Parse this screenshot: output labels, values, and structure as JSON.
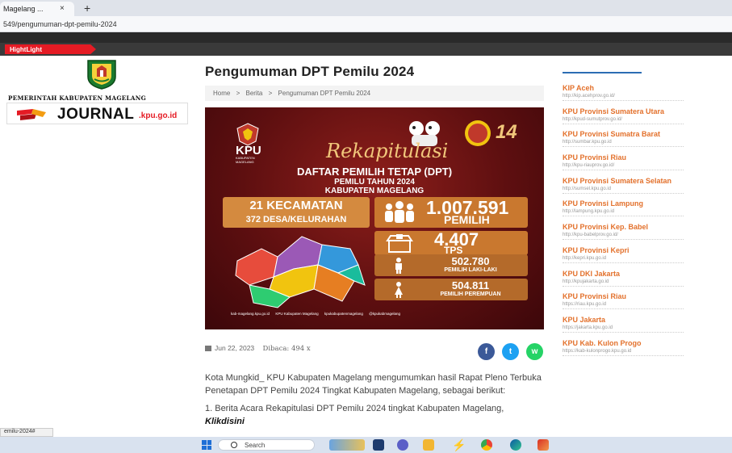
{
  "browser": {
    "tab_title": "Magelang ...",
    "tab_close": "×",
    "new_tab": "+",
    "url": "549/pengumuman-dpt-pemilu-2024"
  },
  "header": {
    "highlight_label": "HightLight"
  },
  "logos": {
    "pemkab_text": "PEMERINTAH KABUPATEN MAGELANG",
    "journal_word": "JOURNAL",
    "journal_sub": ".kpu.go.id"
  },
  "article": {
    "title": "Pengumuman DPT Pemilu 2024",
    "breadcrumb": [
      "Home",
      ">",
      "Berita",
      ">",
      "Pengumuman DPT Pemilu 2024"
    ],
    "date": "Jun 22, 2023",
    "views": "Dibaca: 494 x",
    "paragraph1": "Kota Mungkid_ KPU Kabupaten Magelang mengumumkan hasil Rapat Pleno Terbuka Penetapan DPT Pemilu 2024 Tingkat Kabupaten Magelang, sebagai berikut:",
    "paragraph2_prefix": "1. Berita Acara Rekapitulasi DPT Pemilu 2024 tingkat Kabupaten Magelang, ",
    "paragraph2_link": "Klikdisini"
  },
  "poster": {
    "kpu": "KPU",
    "kpu_sub": "KABUPATEN MAGELANG",
    "rekap": "Rekapitulasi",
    "line1": "DAFTAR PEMILIH TETAP (DPT)",
    "line2": "PEMILU TAHUN 2024",
    "line3": "KABUPATEN MAGELANG",
    "kecamatan": "21 KECAMATAN",
    "desa": "372 DESA/KELURAHAN",
    "pemilih_num": "1.007.591",
    "pemilih_unit": "PEMILIH",
    "tps_num": "4.407",
    "tps_unit": "TPS",
    "laki_num": "502.780",
    "laki_unit": "PEMILIH LAKI-LAKI",
    "perempuan_num": "504.811",
    "perempuan_unit": "PEMILIH PEREMPUAN",
    "day": "14",
    "footer": [
      "kab-magelang.kpu.go.id",
      "KPU Kabupaten Magelang",
      "kpukabupatenmagelang",
      "@kpukabmagelang"
    ]
  },
  "sidebar": {
    "items": [
      {
        "name": "KIP Aceh",
        "url": "http://kip.acehprov.go.id/"
      },
      {
        "name": "KPU Provinsi Sumatera Utara",
        "url": "http://kpud-sumutprov.go.id/"
      },
      {
        "name": "KPU Provinsi Sumatra Barat",
        "url": "http://sumbar.kpu.go.id"
      },
      {
        "name": "KPU Provinsi Riau",
        "url": "http://kpu-riauprov.go.id/"
      },
      {
        "name": "KPU Provinsi Sumatera Selatan",
        "url": "http://sumsel.kpu.go.id"
      },
      {
        "name": "KPU Provinsi Lampung",
        "url": "http://lampung.kpu.go.id"
      },
      {
        "name": "KPU Provinsi Kep. Babel",
        "url": "http://kpu-babelprov.go.id/"
      },
      {
        "name": "KPU Provinsi Kepri",
        "url": "http://kepri.kpu.go.id"
      },
      {
        "name": "KPU DKI Jakarta",
        "url": "http://kpujakarta.go.id"
      },
      {
        "name": "KPU Provinsi Riau",
        "url": "https://riau.kpu.go.id"
      },
      {
        "name": "KPU Jakarta",
        "url": "https://jakarta.kpu.go.id"
      },
      {
        "name": "KPU Kab. Kulon Progo",
        "url": "https://kab-kulonprogo.kpu.go.id"
      }
    ]
  },
  "statusbar": {
    "link": "emilu-2024#"
  },
  "taskbar": {
    "search": "Search"
  },
  "colors": {
    "accent_red": "#e51b24",
    "sidebar_link": "#e3712c",
    "facebook": "#3b5998",
    "twitter": "#1da1f2",
    "whatsapp": "#25d366"
  }
}
